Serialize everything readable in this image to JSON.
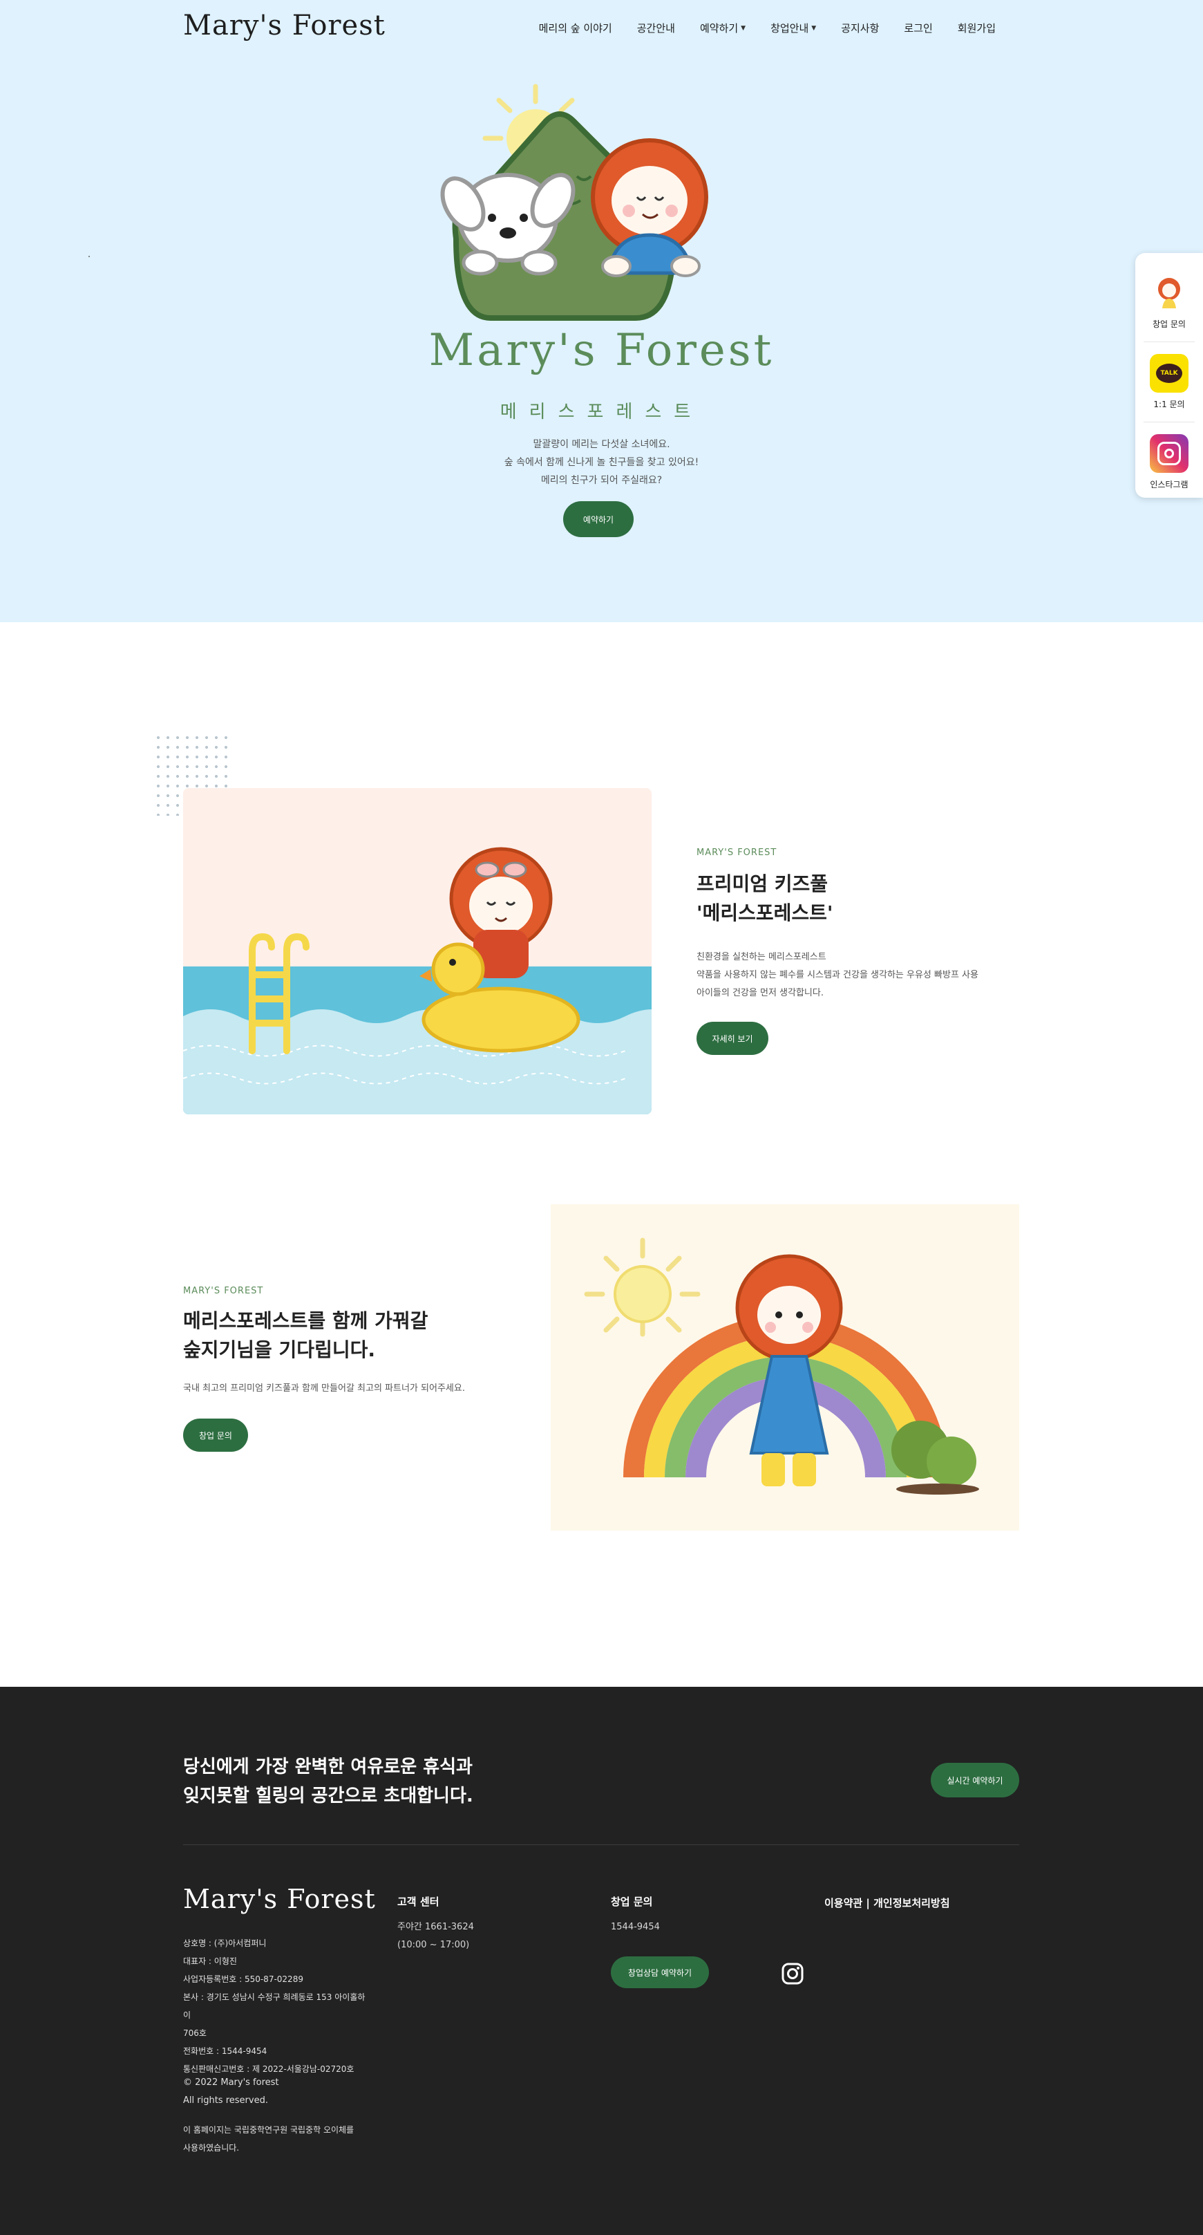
{
  "header": {
    "logo": "Mary's Forest",
    "nav": [
      {
        "label": "메리의 숲 이야기",
        "dropdown": false
      },
      {
        "label": "공간안내",
        "dropdown": false
      },
      {
        "label": "예약하기",
        "dropdown": true
      },
      {
        "label": "창업안내",
        "dropdown": true
      },
      {
        "label": "공지사항",
        "dropdown": false
      },
      {
        "label": "로그인",
        "dropdown": false
      },
      {
        "label": "회원가입",
        "dropdown": false
      }
    ]
  },
  "hero": {
    "title": "Mary's Forest",
    "subtitle": "메리스포레스트",
    "desc": [
      "말괄량이 메리는 다섯살 소녀에요.",
      "숲 속에서 함께 신나게 놀 친구들을 찾고 있어요!",
      "메리의 친구가 되어 주실래요?"
    ],
    "button": "예약하기"
  },
  "quick_menu": [
    {
      "label": "창업 문의",
      "icon": "mary-avatar-icon"
    },
    {
      "label": "1:1 문의",
      "icon": "kakao-talk-icon",
      "icon_text": "TALK"
    },
    {
      "label": "인스타그램",
      "icon": "instagram-icon"
    }
  ],
  "section1": {
    "eyebrow": "MARY'S FOREST",
    "title": [
      "프리미엄 키즈풀",
      "'메리스포레스트'"
    ],
    "body": [
      "친환경을 실천하는 메리스포레스트",
      "약품을 사용하지 않는 폐수를 시스템과 건강을 생각하는 우유성 빠방프 사용",
      "아이들의 건강을 먼저 생각합니다."
    ],
    "button": "자세히 보기"
  },
  "section2": {
    "eyebrow": "MARY'S FOREST",
    "title": [
      "메리스포레스트를 함께 가꿔갈",
      "숲지기님을 기다립니다."
    ],
    "body": "국내 최고의 프리미엄 키즈풀과 함께 만들어갈 최고의 파트너가 되어주세요.",
    "button": "창업 문의"
  },
  "footer": {
    "slogan": [
      "당신에게 가장 완벽한 여유로운 휴식과",
      "잊지못할 힐링의 공간으로 초대합니다."
    ],
    "cta": "실시간 예약하기",
    "logo": "Mary's Forest",
    "company": [
      "상호명 : (주)아서컴퍼니",
      "대표자 : 이형진",
      "사업자등록번호 : 550-87-02289",
      "본사 : 경기도 성남시 수정구 희례동로 153 아이홀하이",
      "706호",
      "전화번호 : 1544-9454",
      "통신판매신고번호 : 제 2022-서울강남-02720호"
    ],
    "copyright": [
      "© 2022 Mary's forest",
      "All rights reserved."
    ],
    "notice": [
      "이 홈페이지는 국립중학연구원 국립중학 오이체를",
      "사용하였습니다."
    ],
    "customer_center": {
      "title": "고객 센터",
      "lines": [
        "주야간 1661-3624",
        "(10:00 ~ 17:00)"
      ]
    },
    "franchise": {
      "title": "창업 문의",
      "phone": "1544-9454",
      "button": "창업상담 예약하기"
    },
    "policy": "이용약관 | 개인정보처리방침"
  },
  "colors": {
    "accent_green": "#2d6e41",
    "hero_bg": "#dff2fe",
    "footer_bg": "#222222",
    "brand_green": "#5b8c5a"
  }
}
